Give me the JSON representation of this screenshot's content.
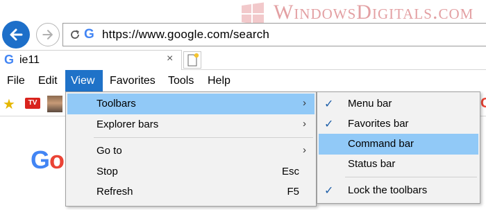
{
  "watermark": {
    "text": "WindowsDigitals.com",
    "logo_icon": "windows-logo-icon"
  },
  "nav": {
    "back_icon": "arrow-left-icon",
    "forward_icon": "arrow-right-icon",
    "refresh_icon": "refresh-icon",
    "favicon": "G",
    "url": "https://www.google.com/search"
  },
  "tab": {
    "favicon": "G",
    "title": "ie11",
    "close": "×"
  },
  "menu_bar": {
    "file": "File",
    "edit": "Edit",
    "view": "View",
    "favorites": "Favorites",
    "tools": "Tools",
    "help": "Help"
  },
  "favorites_bar": {
    "star_icon": "add-favorites-star-icon",
    "tv_label": "TV",
    "right_glyph": "G"
  },
  "page": {
    "logo_partial": "Go"
  },
  "view_menu": {
    "toolbars": "Toolbars",
    "explorer_bars": "Explorer bars",
    "go_to": "Go to",
    "stop": "Stop",
    "stop_shortcut": "Esc",
    "refresh": "Refresh",
    "refresh_shortcut": "F5",
    "arrow": "›"
  },
  "toolbars_menu": {
    "menu_bar": "Menu bar",
    "favorites_bar": "Favorites bar",
    "command_bar": "Command bar",
    "status_bar": "Status bar",
    "lock_toolbars": "Lock the toolbars",
    "check": "✓"
  },
  "colors": {
    "accent_blue": "#1f72c8",
    "menu_highlight": "#91c9f7",
    "watermark": "#e3a0a3"
  }
}
